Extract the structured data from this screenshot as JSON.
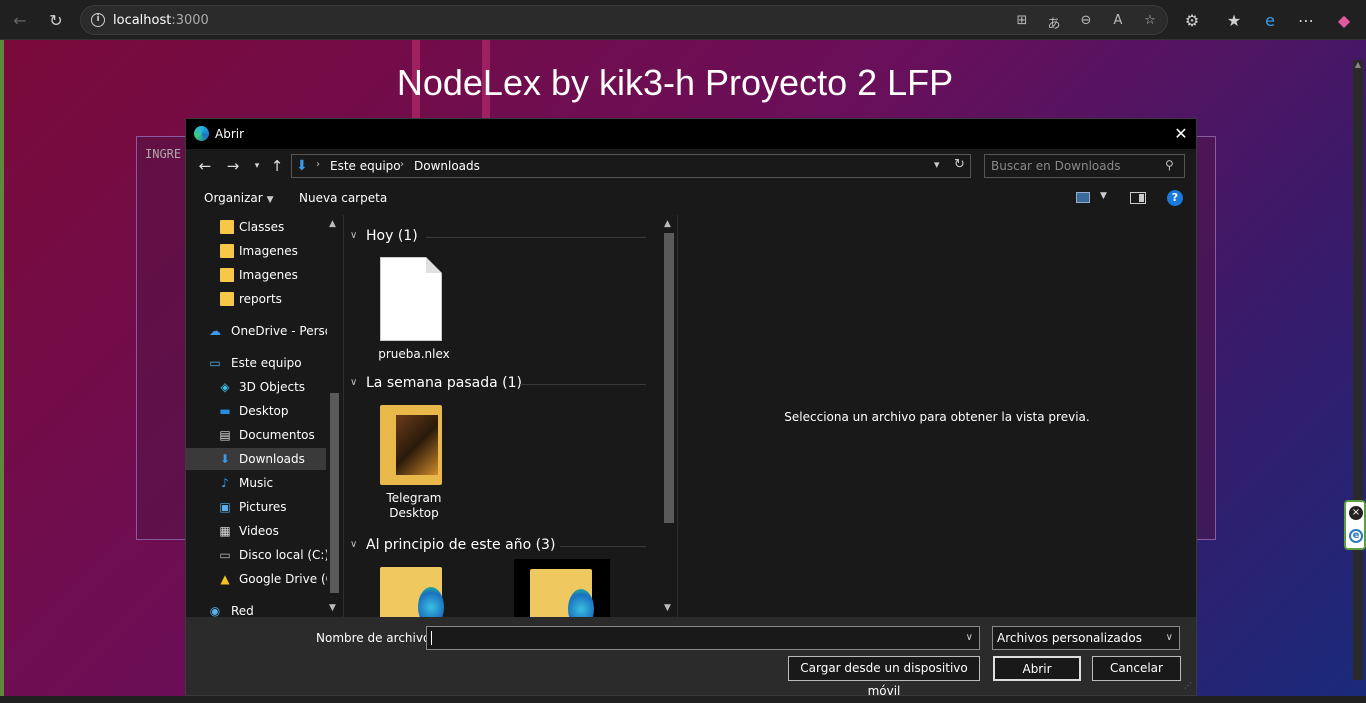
{
  "browser": {
    "url_host": "localhost",
    "url_port": ":3000"
  },
  "page": {
    "title": "NodeLex by kik3-h Proyecto 2 LFP",
    "editor_placeholder": "INGRE"
  },
  "dialog": {
    "title": "Abrir",
    "path": [
      "Este equipo",
      "Downloads"
    ],
    "search_placeholder": "Buscar en Downloads",
    "toolbar": {
      "organize": "Organizar",
      "new_folder": "Nueva carpeta"
    },
    "nav": [
      {
        "label": "Classes",
        "icon": "folder-icon"
      },
      {
        "label": "Imagenes",
        "icon": "folder-icon"
      },
      {
        "label": "Imagenes",
        "icon": "folder-icon"
      },
      {
        "label": "reports",
        "icon": "folder-icon"
      },
      {
        "label": "OneDrive - Persor",
        "icon": "onedrive-icon"
      },
      {
        "label": "Este equipo",
        "icon": "computer-icon"
      },
      {
        "label": "3D Objects",
        "icon": "3d-objects-icon"
      },
      {
        "label": "Desktop",
        "icon": "desktop-icon"
      },
      {
        "label": "Documentos",
        "icon": "documents-icon"
      },
      {
        "label": "Downloads",
        "icon": "downloads-icon",
        "selected": true
      },
      {
        "label": "Music",
        "icon": "music-icon"
      },
      {
        "label": "Pictures",
        "icon": "pictures-icon"
      },
      {
        "label": "Videos",
        "icon": "videos-icon"
      },
      {
        "label": "Disco local (C:)",
        "icon": "drive-icon"
      },
      {
        "label": "Google Drive (G:",
        "icon": "google-drive-icon"
      },
      {
        "label": "Red",
        "icon": "network-icon"
      }
    ],
    "groups": [
      {
        "label": "Hoy (1)"
      },
      {
        "label": "La semana pasada (1)"
      },
      {
        "label": "Al principio de este año (3)"
      }
    ],
    "files": {
      "today": "prueba.nlex",
      "last_week_line1": "Telegram",
      "last_week_line2": "Desktop"
    },
    "preview_message": "Selecciona un archivo para obtener la vista previa.",
    "filename_label": "Nombre de archivo:",
    "filename_value": "",
    "filetype": "Archivos personalizados",
    "buttons": {
      "mobile": "Cargar desde un dispositivo móvil",
      "open": "Abrir",
      "cancel": "Cancelar"
    }
  }
}
